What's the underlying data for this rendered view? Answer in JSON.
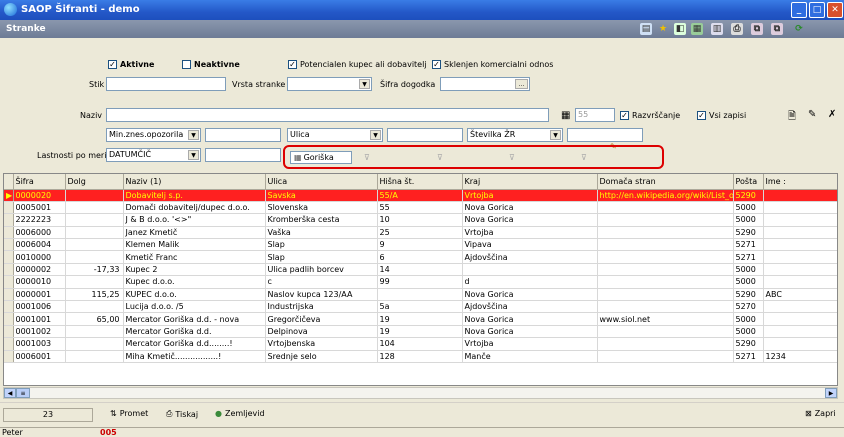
{
  "window": {
    "title": "SAOP Šifranti - demo"
  },
  "caption": {
    "title": "Stranke"
  },
  "filters": {
    "aktivne": {
      "label": "Aktivne",
      "checked": true
    },
    "neaktivne": {
      "label": "Neaktivne",
      "checked": false
    },
    "potencialen": {
      "label": "Potencialen kupec ali dobavitelj",
      "checked": true
    },
    "sklenjen": {
      "label": "Sklenjen komercialni odnos",
      "checked": true
    },
    "stik_label": "Stik",
    "vrsta_label": "Vrsta stranke",
    "sifra_dogodka_label": "Šifra dogodka",
    "ellipsis": "...",
    "naziv_label": "Naziv",
    "naziv_value": "",
    "count_value": "55",
    "razvrscanje": {
      "label": "Razvrščanje",
      "checked": true
    },
    "vsi_zapisi": {
      "label": "Vsi zapisi",
      "checked": true
    },
    "min_znes": "Min.znes.opozorila",
    "ulica": "Ulica",
    "stevilka_zr": "Številka ŽR",
    "lastnosti_label": "Lastnosti po meri",
    "lastnosti_value": "DATUMČIČ"
  },
  "quick_filters": {
    "active": "Goriška"
  },
  "table": {
    "columns": [
      "Šifra",
      "Dolg",
      "Naziv (1)",
      "Ulica",
      "Hišna št.",
      "Kraj",
      "Domača stran",
      "Pošta",
      "Ime :"
    ],
    "rows": [
      [
        "0000020",
        "",
        "Dobavitelj s.p.",
        "Savska",
        "55/A",
        "Vrtojba",
        "http://en.wikipedia.org/wiki/List_of",
        "5290",
        ""
      ],
      [
        "0005001",
        "",
        "Domači dobavitelj/dupec d.o.o.",
        "Slovenska",
        "55",
        "Nova Gorica",
        "",
        "5000",
        ""
      ],
      [
        "2222223",
        "",
        "J & B d.o.o. '<>\"",
        "Kromberška cesta",
        "10",
        "Nova Gorica",
        "",
        "5000",
        ""
      ],
      [
        "0006000",
        "",
        "Janez Kmetič",
        "Vaška",
        "25",
        "Vrtojba",
        "",
        "5290",
        ""
      ],
      [
        "0006004",
        "",
        "Klemen Malik",
        "Slap",
        "9",
        "Vipava",
        "",
        "5271",
        ""
      ],
      [
        "0010000",
        "",
        "Kmetič Franc",
        "Slap",
        "6",
        "Ajdovščina",
        "",
        "5271",
        ""
      ],
      [
        "0000002",
        "-17,33",
        "Kupec 2",
        "Ulica padlih borcev",
        "14",
        "",
        "",
        "5000",
        ""
      ],
      [
        "0000010",
        "",
        "Kupec d.o.o.",
        "c",
        "99",
        "d",
        "",
        "5000",
        ""
      ],
      [
        "0000001",
        "115,25",
        "KUPEC d.o.o.",
        "Naslov kupca 123/AA",
        "",
        "Nova Gorica",
        "",
        "5290",
        "ABC"
      ],
      [
        "0001006",
        "",
        "Lucija d.o.o. /5",
        "Industrijska",
        "5a",
        "Ajdovščina",
        "",
        "5270",
        ""
      ],
      [
        "0001001",
        "65,00",
        "Mercator Goriška d.d. - nova",
        "Gregorčičeva",
        "19",
        "Nova Gorica",
        "www.siol.net",
        "5000",
        ""
      ],
      [
        "0001002",
        "",
        "Mercator Goriška d.d.",
        "Delpinova",
        "19",
        "Nova Gorica",
        "",
        "5000",
        ""
      ],
      [
        "0001003",
        "",
        "Mercator Goriška d.d........!",
        "Vrtojbenska",
        "104",
        "Vrtojba",
        "",
        "5290",
        ""
      ],
      [
        "0006001",
        "",
        "Miha Kmetič.................!",
        "Srednje selo",
        "128",
        "Manče",
        "",
        "5271",
        "1234"
      ]
    ]
  },
  "bottom": {
    "count": "23",
    "promet": "Promet",
    "tiskaj": "Tiskaj",
    "zemljevid": "Zemljevid",
    "zapri": "Zapri"
  },
  "status": {
    "user": "Peter",
    "code": "005"
  }
}
